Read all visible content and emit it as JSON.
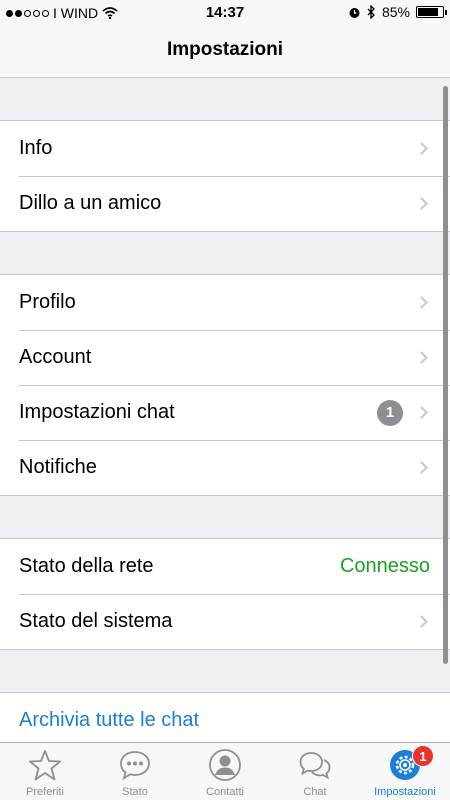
{
  "status_bar": {
    "carrier": "I WIND",
    "time": "14:37",
    "battery": "85%",
    "battery_level": 0.85,
    "signal_bars_filled": 2,
    "signal_bars_total": 5
  },
  "nav": {
    "title": "Impostazioni"
  },
  "sections": {
    "info": {
      "label": "Info"
    },
    "tell_friend": {
      "label": "Dillo a un amico"
    },
    "profile": {
      "label": "Profilo"
    },
    "account": {
      "label": "Account"
    },
    "chat_settings": {
      "label": "Impostazioni chat",
      "badge": "1"
    },
    "notifications": {
      "label": "Notifiche"
    },
    "network_status": {
      "label": "Stato della rete",
      "value": "Connesso"
    },
    "system_status": {
      "label": "Stato del sistema"
    },
    "archive_all": {
      "label": "Archivia tutte le chat"
    }
  },
  "tabs": [
    {
      "label": "Preferiti",
      "icon": "star-icon"
    },
    {
      "label": "Stato",
      "icon": "speech-bubble-dots-icon"
    },
    {
      "label": "Contatti",
      "icon": "person-icon"
    },
    {
      "label": "Chat",
      "icon": "chat-bubbles-icon"
    },
    {
      "label": "Impostazioni",
      "icon": "gear-icon",
      "badge": "1",
      "active": true
    }
  ],
  "colors": {
    "accent": "#1a7fd5",
    "connected": "#1aa31f",
    "badge_red": "#e8352c",
    "badge_gray": "#8e8e93"
  }
}
